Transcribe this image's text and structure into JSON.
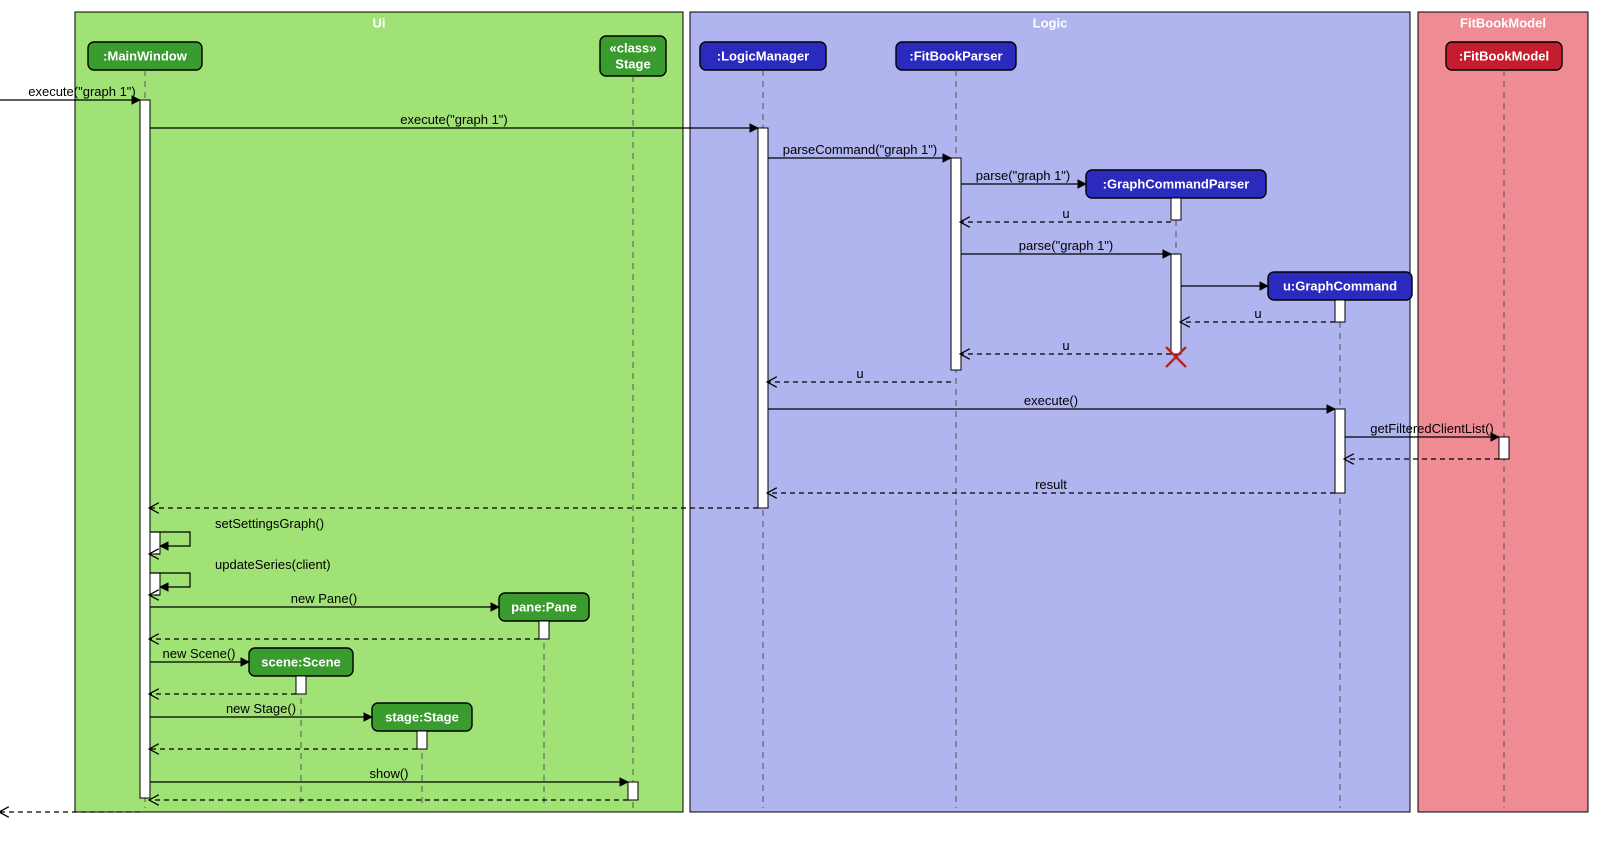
{
  "regions": {
    "ui": {
      "label": "Ui"
    },
    "logic": {
      "label": "Logic"
    },
    "model": {
      "label": "FitBookModel"
    }
  },
  "participants": {
    "mainwindow": {
      "label": ":MainWindow"
    },
    "stageclass": {
      "label1": "«class»",
      "label2": "Stage"
    },
    "logicmanager": {
      "label": ":LogicManager"
    },
    "fitbookparser": {
      "label": ":FitBookParser"
    },
    "graphcommandparser": {
      "label": ":GraphCommandParser"
    },
    "graphcommand": {
      "label": "u:GraphCommand"
    },
    "fitbookmodel": {
      "label": ":FitBookModel"
    },
    "pane": {
      "label": "pane:Pane"
    },
    "scene": {
      "label": "scene:Scene"
    },
    "stage": {
      "label": "stage:Stage"
    }
  },
  "messages": {
    "m1": "execute(\"graph 1\")",
    "m2": "execute(\"graph 1\")",
    "m3": "parseCommand(\"graph 1\")",
    "m4": "parse(\"graph 1\")",
    "m5": "u",
    "m6": "parse(\"graph 1\")",
    "m7": "u",
    "m8": "u",
    "m9": "u",
    "m10": "execute()",
    "m11": "getFilteredClientList()",
    "m12": "result",
    "m13": "setSettingsGraph()",
    "m14": "updateSeries(client)",
    "m15": "new Pane()",
    "m16": "new Scene()",
    "m17": "new Stage()",
    "m18": "show()"
  }
}
